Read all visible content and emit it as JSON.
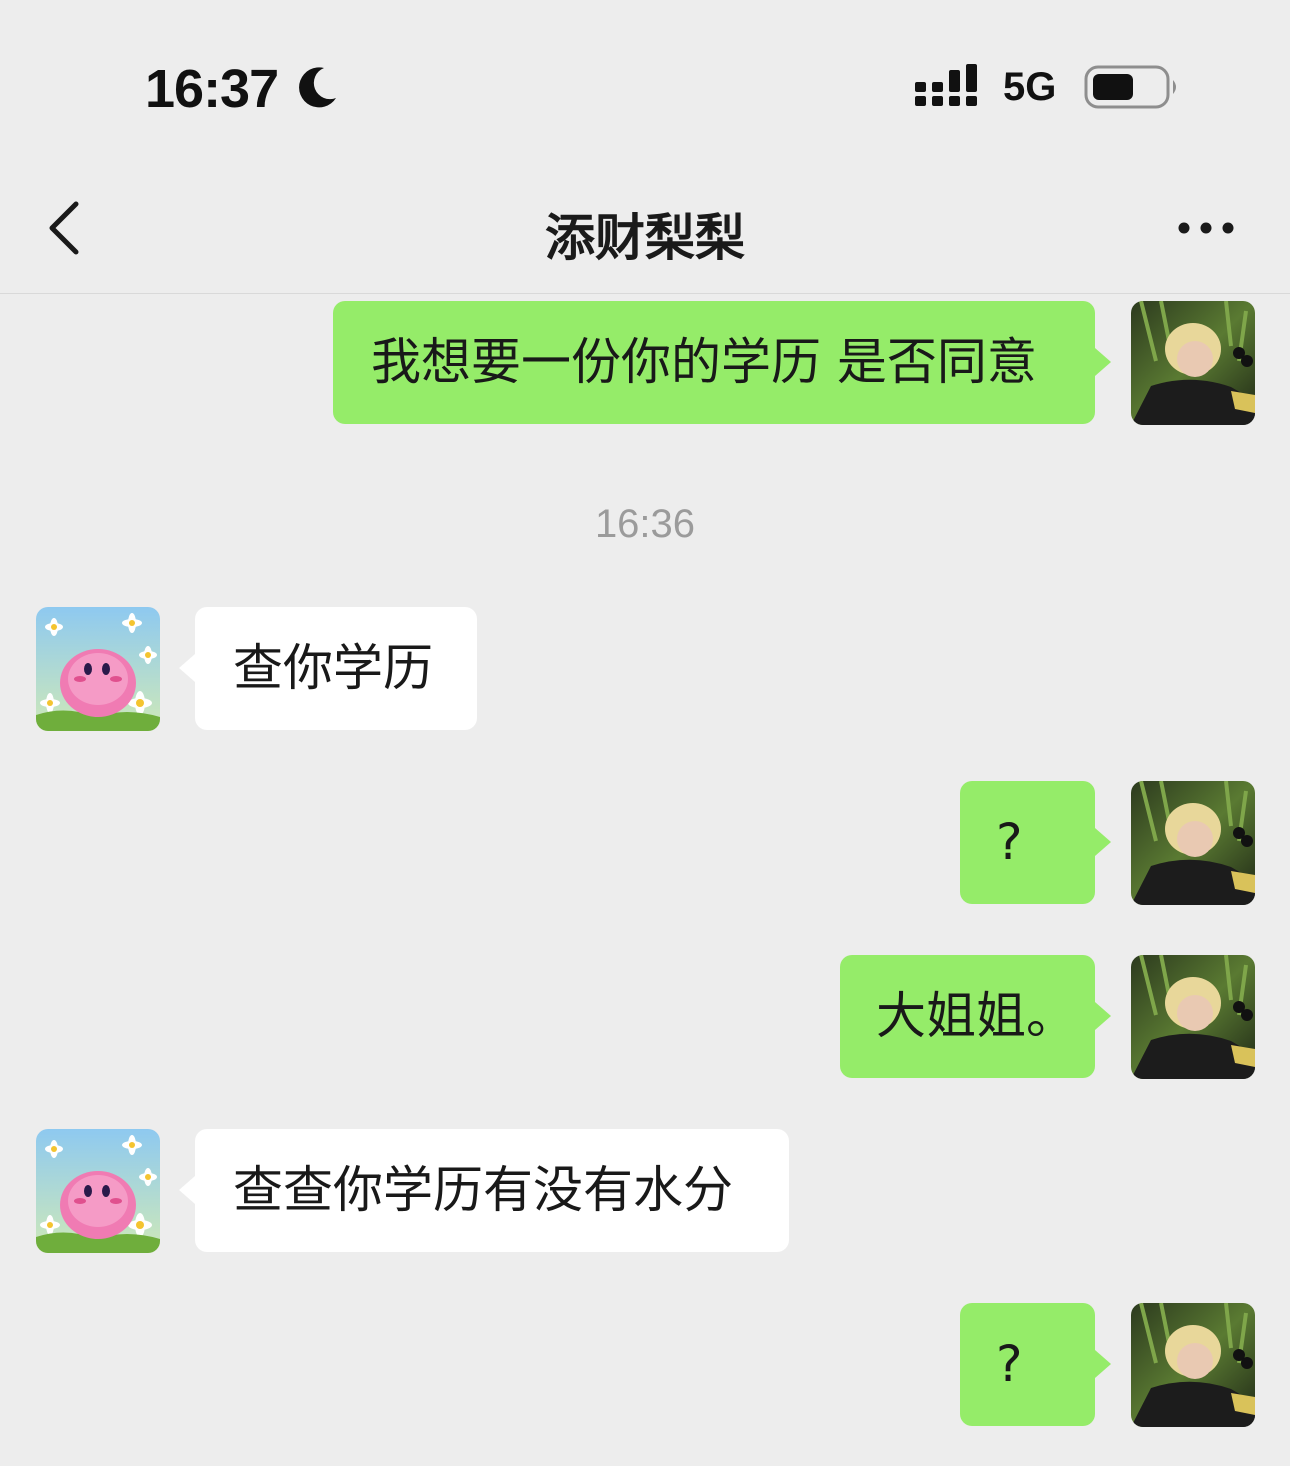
{
  "status_bar": {
    "time": "16:37",
    "network": "5G",
    "icons": [
      "moon-icon",
      "signal-icon",
      "battery-icon"
    ]
  },
  "nav": {
    "title": "添财梨梨",
    "back_icon": "chevron-left-icon",
    "more_icon": "more-icon"
  },
  "colors": {
    "background": "#ededed",
    "sent_bubble": "#95ec69",
    "received_bubble": "#ffffff",
    "timestamp_text": "#9b9b9b"
  },
  "timestamp": "16:36",
  "messages": [
    {
      "side": "sent",
      "text": "我想要一份你的学历 是否同意"
    },
    {
      "side": "received",
      "text": "查你学历"
    },
    {
      "side": "sent",
      "text": "?"
    },
    {
      "side": "sent",
      "text": "大姐姐。"
    },
    {
      "side": "received",
      "text": "查查你学历有没有水分"
    },
    {
      "side": "sent",
      "text": "?"
    }
  ]
}
